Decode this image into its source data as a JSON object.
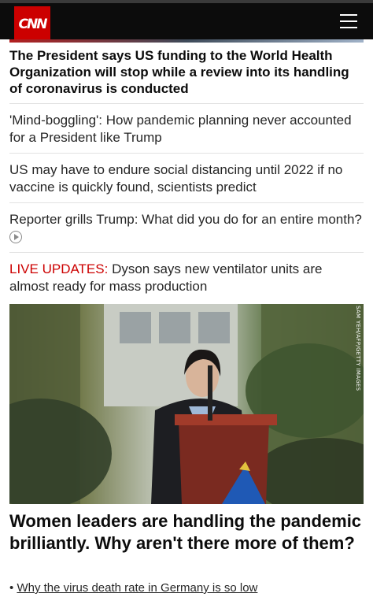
{
  "header": {
    "logo_text": "CNN",
    "menu_icon": "hamburger-icon",
    "brand_color": "#cc0000"
  },
  "stories": [
    {
      "text": "The President says US funding to the World Health Organization will stop while a review into its handling of coronavirus is conducted"
    },
    {
      "text": "'Mind-boggling': How pandemic planning never accounted for a President like Trump"
    },
    {
      "text": "US may have to endure social distancing until 2022 if no vaccine is quickly found, scientists predict"
    },
    {
      "text": "Reporter grills Trump: What did you do for an entire month?",
      "icon": "play-icon"
    },
    {
      "prefix": "LIVE UPDATES:",
      "text": " Dyson says new ventilator units are almost ready for mass production"
    }
  ],
  "feature": {
    "photo_credit": "SAM YEH/AFP/GETTY IMAGES",
    "headline": "Women leaders are handling the pandemic brilliantly. Why aren't there more of them?",
    "related_bullet": "•",
    "related_link": "Why the virus death rate in Germany is so low"
  }
}
